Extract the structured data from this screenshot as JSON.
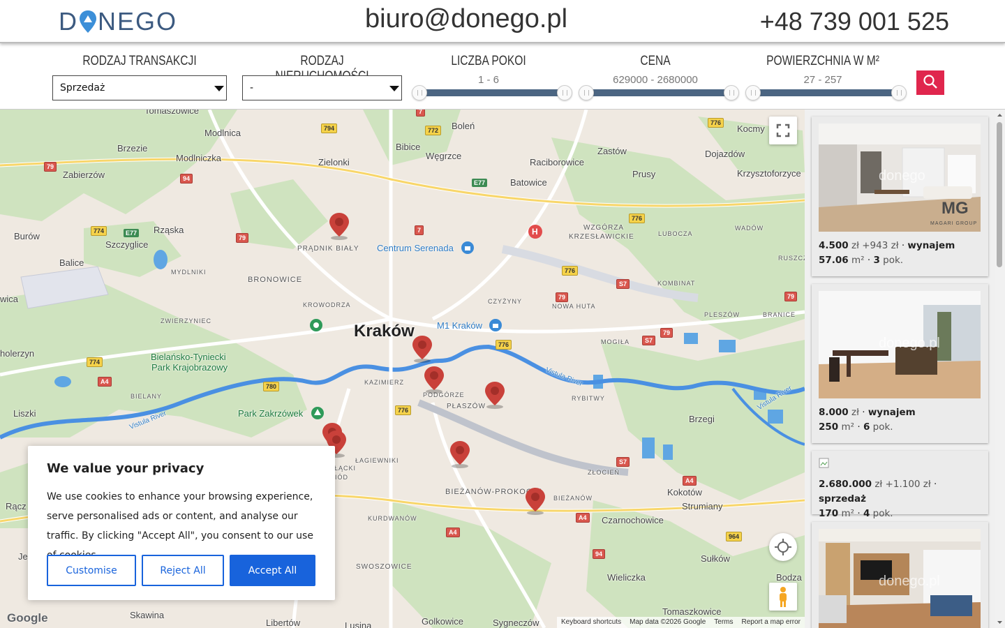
{
  "header": {
    "logo_text": "DONEGO",
    "email": "biuro@donego.pl",
    "phone": "+48 739 001 525"
  },
  "filters": {
    "transaction": {
      "label": "RODZAJ TRANSAKCJI",
      "value": "Sprzedaż"
    },
    "property": {
      "label": "RODZAJ NIERUCHOMOŚCI",
      "value": "-"
    },
    "rooms": {
      "label": "LICZBA POKOI",
      "range": "1 - 6"
    },
    "price": {
      "label": "CENA",
      "range": "629000 - 2680000"
    },
    "area": {
      "label": "POWIERZCHNIA W M²",
      "range": "27 - 257"
    },
    "search_icon": "search-icon"
  },
  "map": {
    "city": "Kraków",
    "labels": {
      "tomaszowice": "Tomaszowice",
      "modlnica": "Modlnica",
      "bolen": "Boleń",
      "brzezie": "Brzezie",
      "modlniczka": "Modlniczka",
      "bibice": "Bibice",
      "wegrzce": "Węgrzce",
      "zastow": "Zastów",
      "dojazdow": "Dojazdów",
      "kocmy": "Kocmy",
      "zabierzow": "Zabierzów",
      "zielonki": "Zielonki",
      "raciborowice": "Raciborowice",
      "prusy": "Prusy",
      "krzysztoforzyce": "Krzysztoforzyce",
      "batowice": "Batowice",
      "burow": "Burów",
      "rzaska": "Rząska",
      "szczyglice": "Szczyglice",
      "pradnik": "PRĄDNIK BIAŁY",
      "wzgorza": "WZGÓRZA",
      "krzeslawickie": "KRZESŁAWICKIE",
      "lubocza": "LUBOCZA",
      "wadow": "WADÓW",
      "ruszcza": "RUSZCZ",
      "balice": "Balice",
      "mydlniki": "MYDLNIKI",
      "bronowice": "BRONOWICE",
      "kombinat": "KOMBINAT",
      "czyzyny": "CZYŻYNY",
      "nowahuta": "NOWA HUTA",
      "krowodrza": "KROWODRZA",
      "zwierzyniec": "ZWIERZYNIEC",
      "pleszow": "PLESZÓW",
      "branice": "BRANICE",
      "wica": "wica",
      "mogila": "MOGIŁA",
      "holerzyn": "holerzyn",
      "bielansko": "Bielańsko-Tyniecki",
      "park": "Park Krajobrazowy",
      "kazimierz": "KAZIMIERZ",
      "rybitwy": "RYBITWY",
      "podgorze": "PODGÓRZE",
      "plaszow": "PŁASZÓW",
      "bielany": "BIELANY",
      "brzegi": "Brzegi",
      "liszki": "Liszki",
      "lagiewniki": "ŁAGIEWNIKI",
      "zlocien": "ZŁOCIEŃ",
      "kokotow": "Kokotów",
      "bieznow_p": "BIEŻANÓW-PROKOCIM",
      "bieznow": "BIEŻANÓW",
      "strumiany": "Strumiany",
      "kurdwanow": "KURDWANÓW",
      "czarnochowice": "Czarnochowice",
      "swoszowice": "SWOSZOWICE",
      "sulkow": "Sułków",
      "wieliczka": "Wieliczka",
      "bodza": "Bodza",
      "skawina": "Skawina",
      "tomaszkowice": "Tomaszkowice",
      "libertow": "Libertów",
      "golkowice": "Golkowice",
      "sygneczow": "Sygneczów",
      "lusina": "Lusina",
      "rz": "Rącz",
      "je": "Je",
      "vistula1": "Vistula River",
      "vistula2": "Vistula River",
      "vistula3": "Vistula River",
      "centrum": "Centrum Serenada",
      "m1": "M1 Kraków",
      "zakrzowek": "Park Zakrzówek",
      "slod": "ŁĄCKI",
      "iod": "IÓD"
    },
    "roads": [
      "794",
      "772",
      "776",
      "79",
      "94",
      "774",
      "E77",
      "7",
      "776",
      "7",
      "79",
      "S7",
      "79",
      "S7",
      "776",
      "774",
      "A4",
      "780",
      "776",
      "S7",
      "A4",
      "A4",
      "A4",
      "964",
      "94",
      "79",
      "79",
      "E77"
    ],
    "google_logo": "Google",
    "attribution": [
      "Keyboard shortcuts",
      "Map data ©2026 Google",
      "Terms",
      "Report a map error"
    ]
  },
  "cookie": {
    "title": "We value your privacy",
    "text": "We use cookies to enhance your browsing experience, serve personalised ads or content, and analyse our traffic. By clicking \"Accept All\", you consent to our use of cookies.",
    "customise": "Customise",
    "reject": "Reject All",
    "accept": "Accept All"
  },
  "listings": [
    {
      "price": "4.500",
      "currency": "zł",
      "extra": "+943 zł",
      "sep": "·",
      "type": "wynajem",
      "area": "57.06",
      "area_unit": "m²",
      "rooms": "3",
      "rooms_unit": "pok.",
      "watermark": "donego",
      "brand": "MAGARI GROUP",
      "brand_mark": "MG"
    },
    {
      "price": "8.000",
      "currency": "zł",
      "extra": "",
      "sep": "·",
      "type": "wynajem",
      "area": "250",
      "area_unit": "m²",
      "rooms": "6",
      "rooms_unit": "pok.",
      "watermark": "donego.pl"
    },
    {
      "price": "2.680.000",
      "currency": "zł",
      "extra": "+1.100 zł",
      "sep": "·",
      "type": "sprzedaż",
      "area": "170",
      "area_unit": "m²",
      "rooms": "4",
      "rooms_unit": "pok."
    },
    {
      "watermark": "donego.pl"
    }
  ]
}
